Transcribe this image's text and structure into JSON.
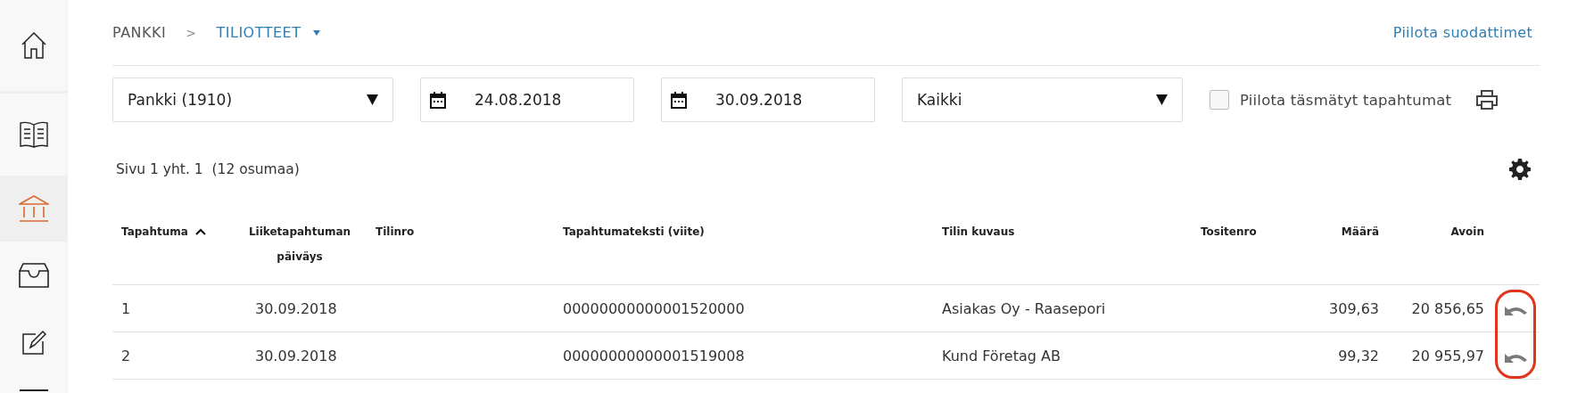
{
  "sidebar": {
    "items": [
      {
        "selected": false
      },
      {
        "selected": false
      },
      {
        "selected": true
      },
      {
        "selected": false
      },
      {
        "selected": false
      },
      {
        "selected": false
      }
    ]
  },
  "breadcrumb": {
    "items": [
      "PANKKI",
      "TILIOTTEET"
    ],
    "separator": ">"
  },
  "hide_filters_link": "Piilota suodattimet",
  "filters": {
    "account": {
      "value": "Pankki (1910)"
    },
    "start_date": {
      "value": "24.08.2018"
    },
    "end_date": {
      "value": "30.09.2018"
    },
    "status": {
      "value": "Kaikki"
    },
    "hide_matched": {
      "label": "Piilota täsmätyt tapahtumat",
      "checked": false
    }
  },
  "page_info": "Sivu 1 yht. 1  (12 osumaa)",
  "table": {
    "columns": [
      {
        "label": "Tapahtuma",
        "sorted": true
      },
      {
        "label": "Liiketapahtuman päiväys",
        "sorted": false
      },
      {
        "label": "Tilinro",
        "sorted": false
      },
      {
        "label": "Tapahtumateksti (viite)",
        "sorted": false
      },
      {
        "label": "Tilin kuvaus",
        "sorted": false
      },
      {
        "label": "Tositenro",
        "sorted": false
      },
      {
        "label": "Määrä",
        "sorted": false
      },
      {
        "label": "Avoin",
        "sorted": false
      }
    ],
    "rows": [
      {
        "tapahtuma": "1",
        "paivays": "30.09.2018",
        "viite": "00000000000001520000",
        "kuvaus": "Asiakas Oy - Raasepori",
        "maara": "309,63",
        "avoin": "20 856,65"
      },
      {
        "tapahtuma": "2",
        "paivays": "30.09.2018",
        "viite": "00000000000001519008",
        "kuvaus": "Kund Företag AB",
        "maara": "99,32",
        "avoin": "20 955,97"
      }
    ]
  }
}
